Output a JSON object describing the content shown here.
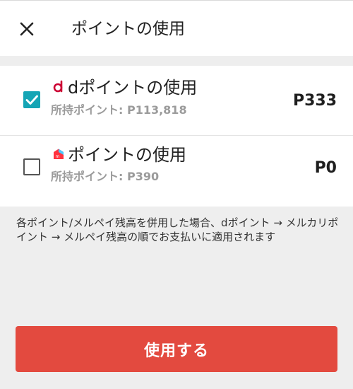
{
  "header": {
    "title": "ポイントの使用",
    "close_icon": "close-icon"
  },
  "options": [
    {
      "title": "dポイントの使用",
      "held_label": "所持ポイント: P113,818",
      "amount": "P333",
      "checked": true,
      "icon": "d-point-logo-icon",
      "icon_color": "#cc0033"
    },
    {
      "title": "ポイントの使用",
      "held_label": "所持ポイント: P390",
      "amount": "P0",
      "checked": false,
      "icon": "merpay-logo-icon",
      "icon_color": "#ff333f"
    }
  ],
  "note": {
    "text": "各ポイント/メルペイ残高を併用した場合、dポイント → メルカリポイント → メルペイ残高の順でお支払いに適用されます"
  },
  "primary_button": {
    "label": "使用する",
    "color": "#e34a3f"
  },
  "colors": {
    "checkbox_checked": "#15a5b5",
    "background": "#eeeeee"
  }
}
